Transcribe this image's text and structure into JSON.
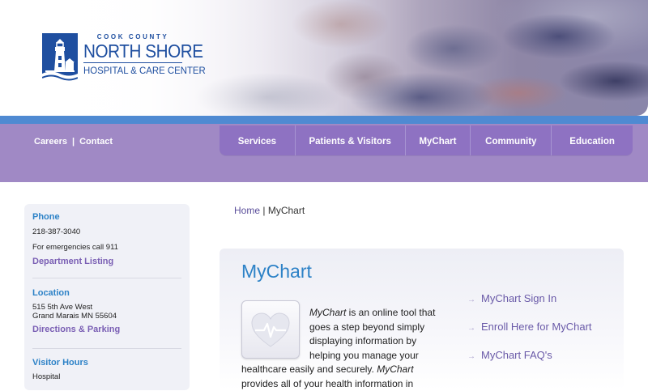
{
  "logo": {
    "county": "COOK COUNTY",
    "name": "NORTH SHORE",
    "subtitle": "HOSPITAL & CARE CENTER"
  },
  "utility_nav": {
    "careers": "Careers",
    "separator": "|",
    "contact": "Contact"
  },
  "main_nav": [
    {
      "label": "Services"
    },
    {
      "label": "Patients & Visitors"
    },
    {
      "label": "MyChart"
    },
    {
      "label": "Community"
    },
    {
      "label": "Education"
    }
  ],
  "sidebar": {
    "phone": {
      "heading": "Phone",
      "number": "218-387-3040",
      "emergency": "For emergencies call 911",
      "link": "Department Listing"
    },
    "location": {
      "heading": "Location",
      "address_line1": "515 5th Ave West",
      "address_line2": "Grand Marais MN 55604",
      "link": "Directions & Parking"
    },
    "visitor_hours": {
      "heading": "Visitor Hours",
      "text": "Hospital"
    }
  },
  "breadcrumb": {
    "home": "Home",
    "separator": "|",
    "current": "MyChart"
  },
  "panel": {
    "title": "MyChart",
    "description_italic_1": "MyChart",
    "description_1": " is an online tool that goes a step beyond simply displaying information by helping you manage your healthcare easily and securely. ",
    "description_italic_2": "MyChart",
    "description_2": " provides all of your health information in",
    "quick_links": [
      {
        "label": "MyChart Sign In"
      },
      {
        "label": "Enroll Here for MyChart"
      },
      {
        "label": "MyChart FAQ's"
      }
    ]
  },
  "colors": {
    "nav_purple": "#8e72c2",
    "band_purple": "#a089c5",
    "accent_blue": "#2d82c7",
    "strip_blue": "#4f8ad2",
    "link_purple": "#7a5fb4"
  }
}
